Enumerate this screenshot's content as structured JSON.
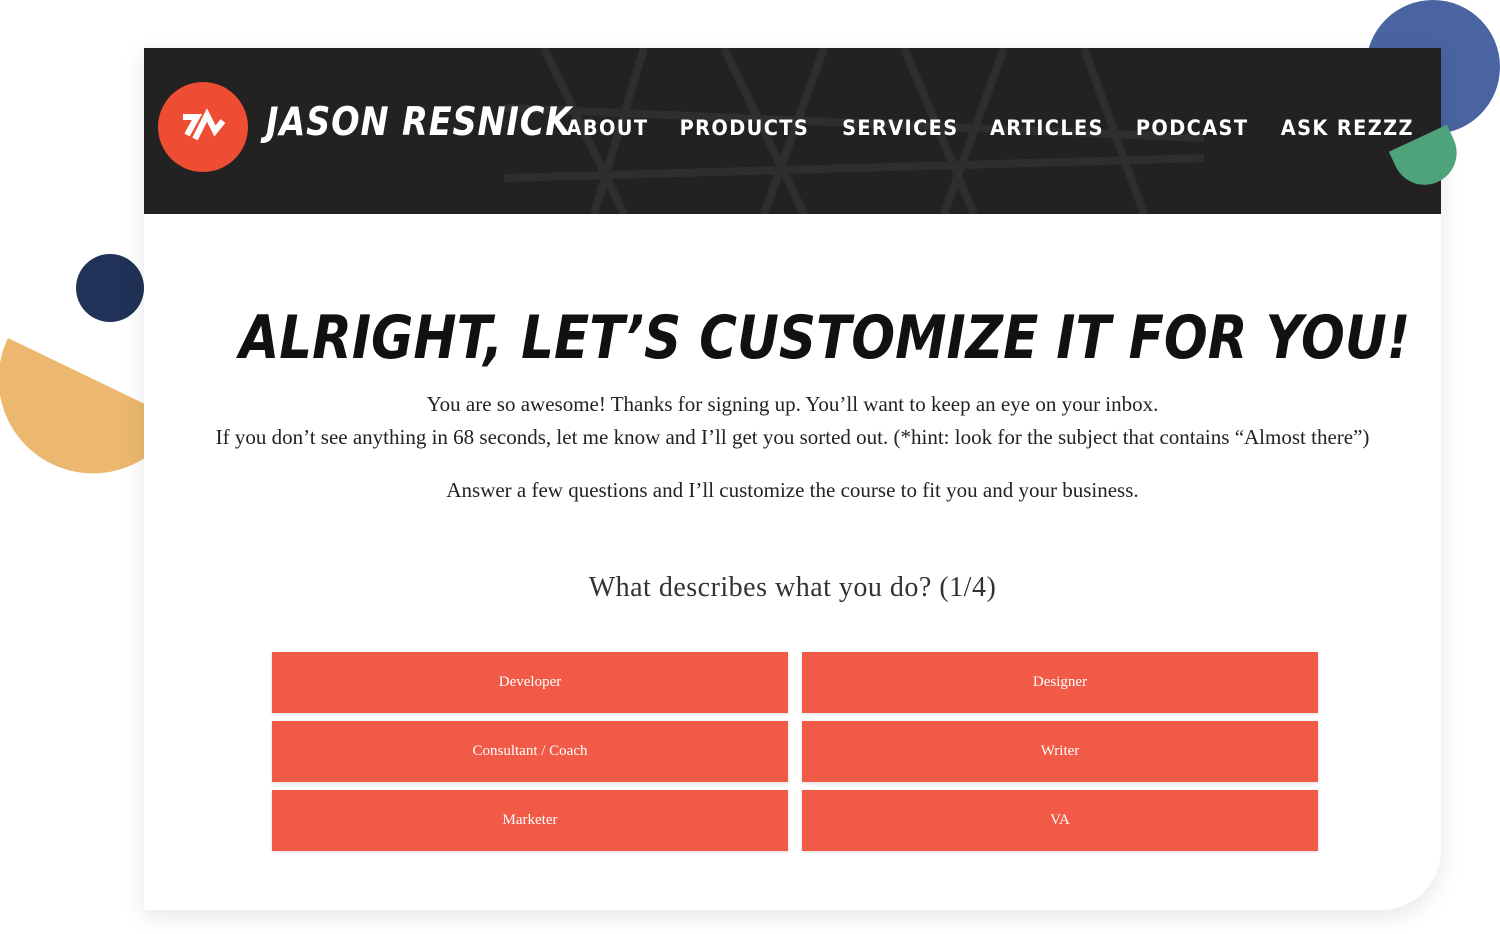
{
  "brand": {
    "name": "JASON RESNICK"
  },
  "nav": {
    "items": [
      "ABOUT",
      "PRODUCTS",
      "SERVICES",
      "ARTICLES",
      "PODCAST",
      "ASK REZZZ"
    ]
  },
  "main": {
    "headline": "ALRIGHT, LET’S CUSTOMIZE IT FOR YOU!",
    "intro_line1": "You are so awesome! Thanks for signing up. You’ll want to keep an eye on your inbox.",
    "intro_line2": "If you don’t see anything in 68 seconds, let me know and I’ll get you sorted out. (*hint: look for the subject that contains “Almost there”)",
    "intro_line3": "Answer a few questions and I’ll customize the course to fit you and your business.",
    "question": "What describes what you do? (1/4)",
    "options": [
      "Developer",
      "Designer",
      "Consultant / Coach",
      "Writer",
      "Marketer",
      "VA"
    ]
  },
  "colors": {
    "accent": "#f05a46",
    "header_bg": "#222222",
    "deco_blue": "#4a64a2",
    "deco_navy": "#203257",
    "deco_gold": "#ecb86f",
    "deco_green": "#4fa37a"
  },
  "icons": {
    "logo": "jr-monogram-logo"
  }
}
